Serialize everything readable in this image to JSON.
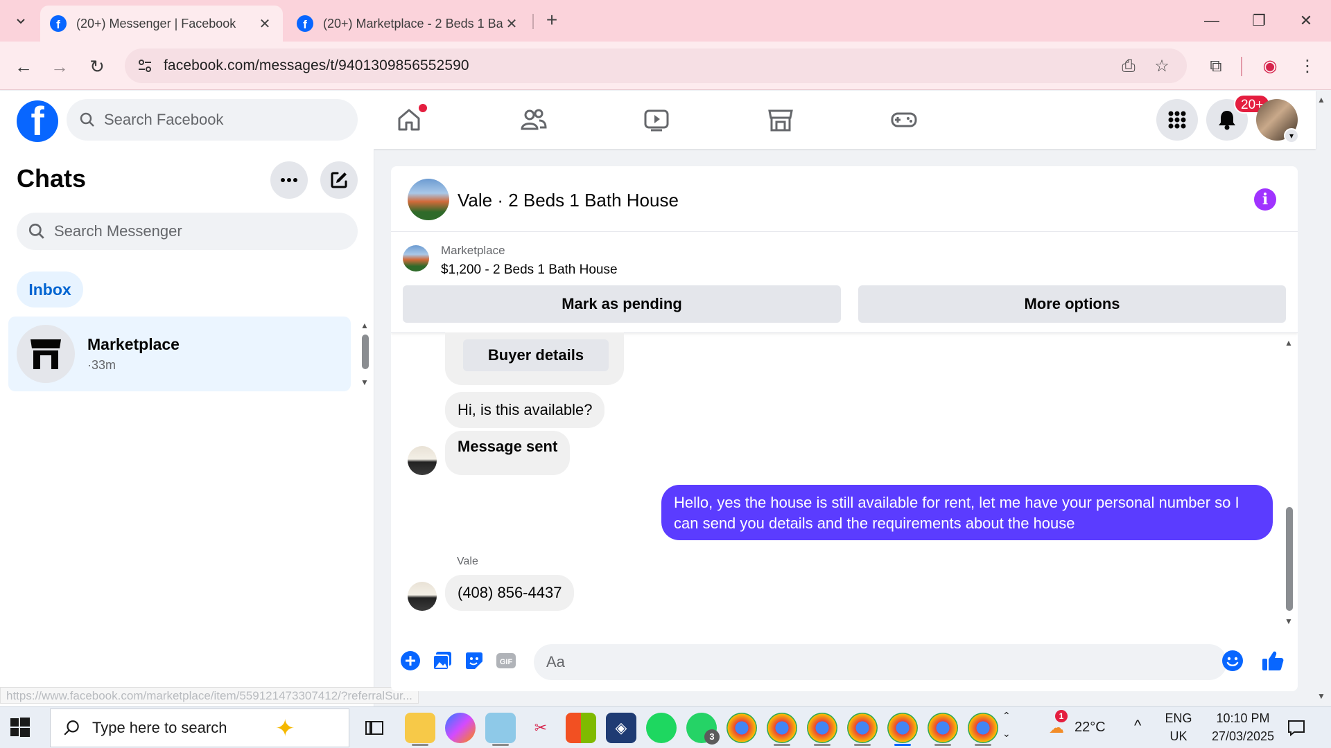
{
  "browser": {
    "tabs": [
      {
        "title": "(20+) Messenger | Facebook",
        "active": true
      },
      {
        "title": "(20+) Marketplace - 2 Beds 1 Ba",
        "active": false
      }
    ],
    "url": "facebook.com/messages/t/9401309856552590",
    "window_controls": {
      "minimize": "—",
      "restore": "❐",
      "close": "✕"
    }
  },
  "fb_nav": {
    "logo": "f",
    "search_placeholder": "Search Facebook",
    "notifications_badge": "20+"
  },
  "sidebar": {
    "title": "Chats",
    "search_placeholder": "Search Messenger",
    "filter_chip": "Inbox",
    "chats": [
      {
        "name": "Marketplace",
        "time": "·33m"
      }
    ]
  },
  "status_url": "https://www.facebook.com/marketplace/item/559121473307412/?referralSur...",
  "conversation": {
    "title": "Vale · 2 Beds 1 Bath House",
    "listing": {
      "label": "Marketplace",
      "price_title": "$1,200 - 2 Beds 1 Bath House",
      "primary_action": "Mark as pending",
      "secondary_action": "More options"
    },
    "messages": {
      "buyer_details_button": "Buyer details",
      "incoming_1": "Hi, is this available?",
      "incoming_2": "Message sent",
      "outgoing_1": "Hello, yes the house is still available for rent, let me have your personal number so I can send you details and the requirements about the house",
      "sender_name": "Vale",
      "incoming_3": "(408) 856-4437"
    },
    "composer_placeholder": "Aa",
    "accent_color": "#5b3cff"
  },
  "taskbar": {
    "search_placeholder": "Type here to search",
    "whatsapp_count": "3",
    "weather_badge": "1",
    "temperature": "22°C",
    "language": "ENG",
    "region": "UK",
    "time": "10:10 PM",
    "date": "27/03/2025"
  }
}
